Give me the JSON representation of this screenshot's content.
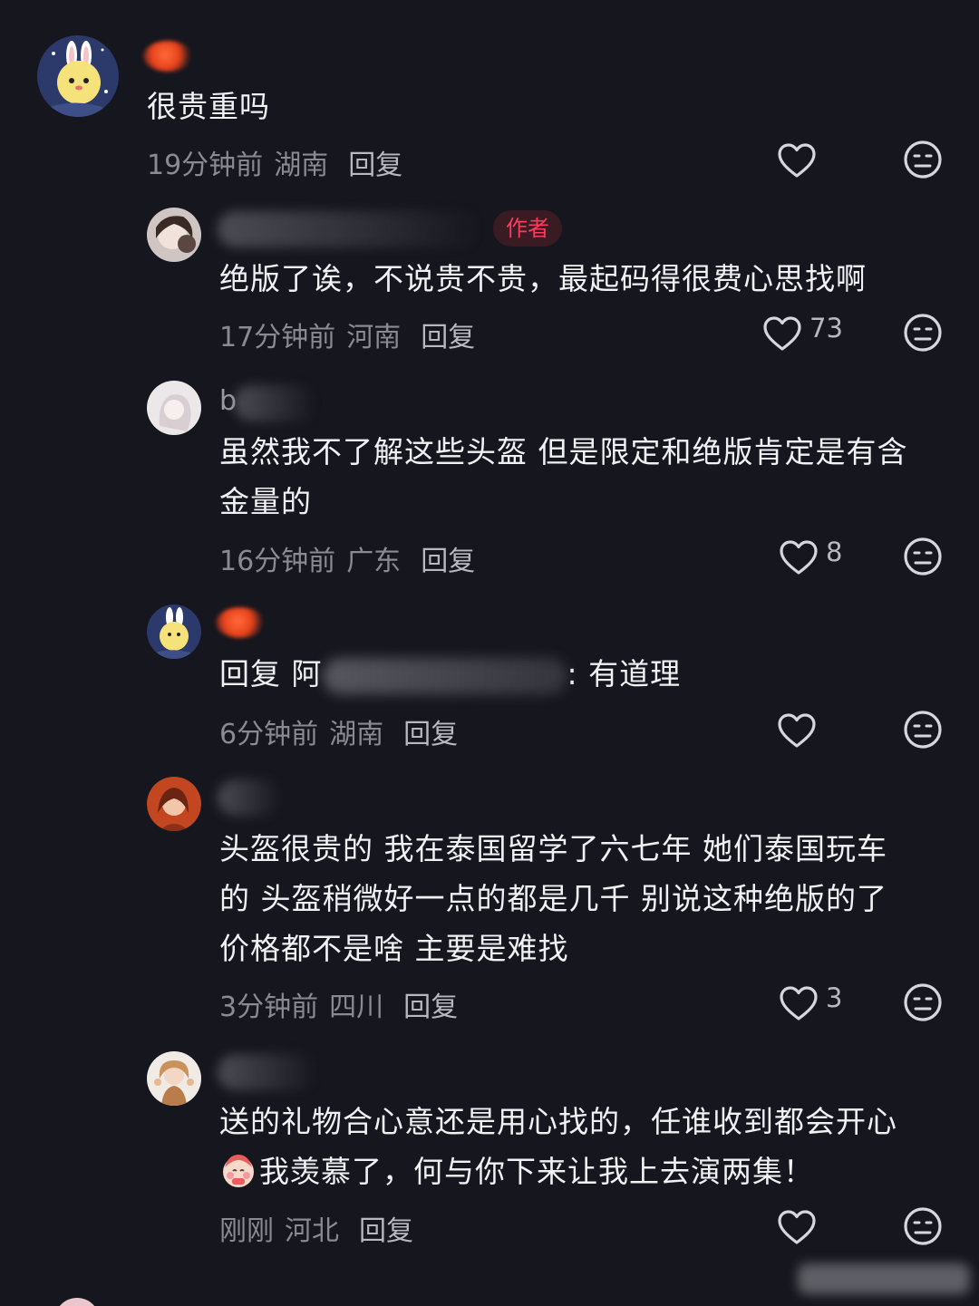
{
  "comments": [
    {
      "text": "很贵重吗",
      "time": "19分钟前",
      "location": "湖南",
      "reply_label": "回复",
      "likes": ""
    },
    {
      "author_badge": "作者",
      "text": "绝版了诶，不说贵不贵，最起码得很费心思找啊",
      "time": "17分钟前",
      "location": "河南",
      "reply_label": "回复",
      "likes": "73"
    },
    {
      "username_partial": "b",
      "text_line1": "虽然我不了解这些头盔 但是限定和绝版肯定是有含",
      "text_line2": "金量的",
      "time": "16分钟前",
      "location": "广东",
      "reply_label": "回复",
      "likes": "8"
    },
    {
      "reply_prefix": "回复 阿",
      "reply_suffix": ": 有道理",
      "time": "6分钟前",
      "location": "湖南",
      "reply_label": "回复",
      "likes": ""
    },
    {
      "text_line1": "头盔很贵的 我在泰国留学了六七年 她们泰国玩车",
      "text_line2": "的 头盔稍微好一点的都是几千 别说这种绝版的了",
      "text_line3": "价格都不是啥 主要是难找",
      "time": "3分钟前",
      "location": "四川",
      "reply_label": "回复",
      "likes": "3"
    },
    {
      "text_line1": "送的礼物合心意还是用心找的，任谁收到都会开心",
      "text_line2": "我羡慕了，何与你下来让我上去演两集！",
      "time": "刚刚",
      "location": "河北",
      "reply_label": "回复",
      "likes": ""
    }
  ],
  "icons": {
    "like": "heart-outline-icon",
    "dislike": "meh-face-icon"
  },
  "colors": {
    "background": "#16161e",
    "text": "#f1f1f3",
    "meta": "#8a8a93",
    "author_badge": "#ff3b5c"
  }
}
